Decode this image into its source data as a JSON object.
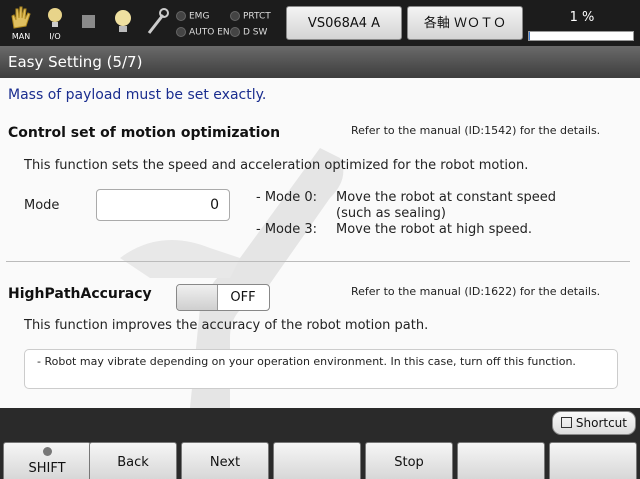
{
  "top_bar": {
    "man_label": "MAN",
    "io_label": "I/O",
    "lamps": [
      "EMG",
      "PRTCT",
      "AUTO EN",
      "D SW"
    ],
    "robot_button": "VS068A4 A",
    "axis_button": "各軸 ＷＯＴＯ",
    "speed_text": "1 %",
    "speed_fraction": 0.01,
    "accent_color": "#3a7bd5"
  },
  "title": "Easy Setting (5/7)",
  "warning": "Mass of payload must be set exactly.",
  "motion_opt": {
    "heading": "Control set of motion optimization",
    "ref": "Refer to the manual (ID:1542) for the details.",
    "desc": "This function sets the speed and acceleration optimized for the robot motion.",
    "mode_label": "Mode",
    "mode_value": "0",
    "modes": [
      {
        "key": "- Mode 0:",
        "text": "Move the robot at constant speed"
      },
      {
        "key": "",
        "text": "(such as sealing)"
      },
      {
        "key": "- Mode 3:",
        "text": "Move the robot at high speed."
      }
    ]
  },
  "high_path": {
    "heading": "HighPathAccuracy",
    "toggle": "OFF",
    "ref": "Refer to the manual (ID:1622) for the details.",
    "desc": "This function improves the accuracy of the robot motion path.",
    "note": "- Robot may vibrate depending on your operation environment. In this case, turn off this function."
  },
  "shortcut": "Shortcut",
  "fkeys": [
    "SHIFT",
    "Back",
    "Next",
    "",
    "Stop",
    "",
    ""
  ]
}
